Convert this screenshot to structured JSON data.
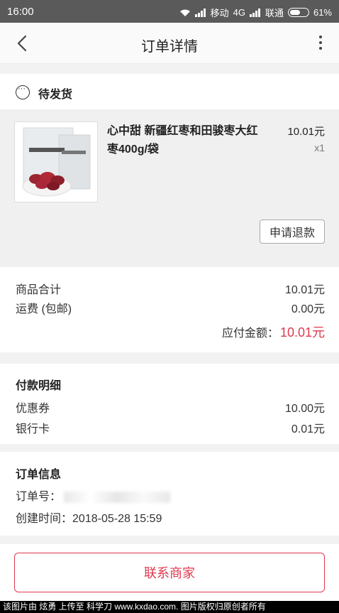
{
  "status_bar": {
    "time": "16:00",
    "carrier1": "移动",
    "network": "4G",
    "carrier2": "联通",
    "battery": "61%",
    "battery_level": 0.61
  },
  "nav": {
    "title": "订单详情",
    "back_icon": "chevron-left-icon",
    "more_icon": "more-vertical-icon"
  },
  "order_status": {
    "icon": "clock-pending-icon",
    "label": "待发货"
  },
  "product": {
    "name": "心中甜 新疆红枣和田骏枣大红枣400g/袋",
    "price": "10.01元",
    "qty": "x1",
    "refund_label": "申请退款"
  },
  "summary": {
    "subtotal_label": "商品合计",
    "subtotal_value": "10.01元",
    "shipping_label": "运费 (包邮)",
    "shipping_value": "0.00元",
    "total_label": "应付金额：",
    "total_value": "10.01元"
  },
  "payment": {
    "title": "付款明细",
    "items": [
      {
        "label": "优惠券",
        "value": "10.00元"
      },
      {
        "label": "银行卡",
        "value": "0.01元"
      }
    ]
  },
  "order_info": {
    "title": "订单信息",
    "order_no_label": "订单号：",
    "created_label": "创建时间：",
    "created_value": "2018-05-28 15:59"
  },
  "contact": {
    "label": "联系商家"
  },
  "footer": {
    "text": "该图片由 炫勇 上传至 科学刀 www.kxdao.com. 图片版权归原创者所有"
  },
  "colors": {
    "accent": "#e0384e",
    "status_bar": "#5a5a5a"
  }
}
